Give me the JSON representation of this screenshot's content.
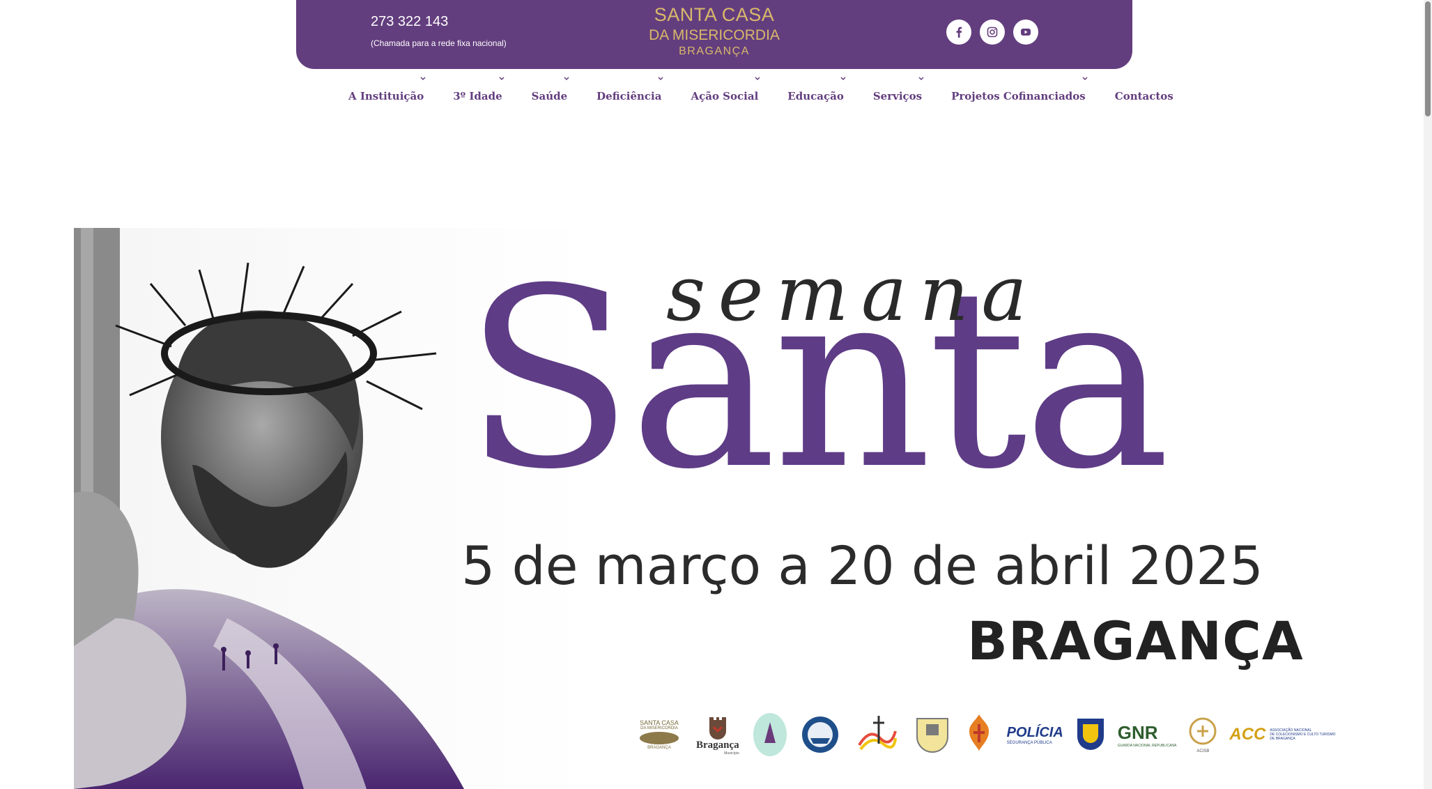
{
  "header": {
    "phone": "273 322 143",
    "phone_note": "(Chamada para a rede fixa nacional)",
    "logo": {
      "line1": "SANTA CASA",
      "line2": "DA MISERICORDIA",
      "line3": "BRAGANÇA"
    },
    "social": [
      {
        "name": "facebook-icon"
      },
      {
        "name": "instagram-icon"
      },
      {
        "name": "youtube-icon"
      }
    ],
    "colors": {
      "header_bg": "#633e7e",
      "logo_gold": "#d9b96a"
    }
  },
  "nav": {
    "items": [
      {
        "label": "A Instituição",
        "dropdown": true
      },
      {
        "label": "3º Idade",
        "dropdown": true
      },
      {
        "label": "Saúde",
        "dropdown": true
      },
      {
        "label": "Deficiência",
        "dropdown": true
      },
      {
        "label": "Ação Social",
        "dropdown": true
      },
      {
        "label": "Educação",
        "dropdown": true
      },
      {
        "label": "Serviços",
        "dropdown": true
      },
      {
        "label": "Projetos Cofinanciados",
        "dropdown": true
      },
      {
        "label": "Contactos",
        "dropdown": false
      }
    ]
  },
  "banner": {
    "script_title": "semana",
    "main_title": "Santa",
    "dates": "5 de março a 20 de abril 2025",
    "city": "BRAGANÇA",
    "partners": {
      "santa_casa": {
        "l1": "SANTA CASA",
        "l2": "DA MISERICORDIA",
        "l3": "BRAGANÇA"
      },
      "braganca": {
        "name": "Bragança",
        "sub": "Município"
      },
      "policia": {
        "name": "POLÍCIA",
        "sub": "SEGURANÇA PÚBLICA"
      },
      "gnr": {
        "name": "GNR",
        "sub": "GUARDA NACIONAL REPUBLICANA"
      },
      "acisb": {
        "name": "ACISB"
      },
      "ascc": {
        "name": "ACC",
        "sub1": "ASSOCIAÇÃO NACIONAL",
        "sub2": "DE COLECIONISMO E CULTO TURISMO",
        "sub3": "DE BRAGANÇA"
      }
    }
  }
}
